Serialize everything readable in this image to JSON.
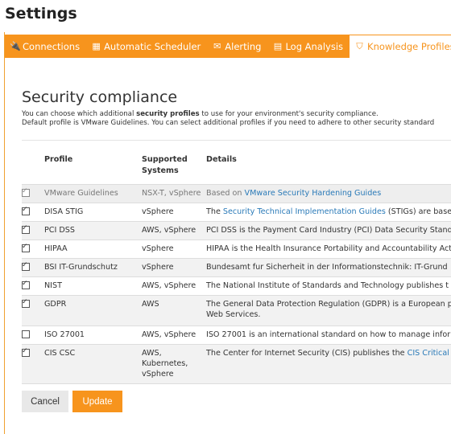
{
  "page": {
    "title": "Settings"
  },
  "tabs": [
    {
      "label": "Connections",
      "icon": "plug-icon",
      "glyph": "🔌"
    },
    {
      "label": "Automatic Scheduler",
      "icon": "calendar-icon",
      "glyph": "▦"
    },
    {
      "label": "Alerting",
      "icon": "envelope-icon",
      "glyph": "✉"
    },
    {
      "label": "Log Analysis",
      "icon": "book-icon",
      "glyph": "▤"
    },
    {
      "label": "Knowledge Profiles",
      "icon": "shield-icon",
      "glyph": "⛉",
      "active": true
    }
  ],
  "section": {
    "title": "Security compliance",
    "desc_line1_pre": "You can choose which additional ",
    "desc_line1_bold": "security profiles",
    "desc_line1_post": " to use for your environment's security compliance.",
    "desc_line2": "Default profile is VMware Guidelines. You can select additional profiles if you need to adhere to other security standard"
  },
  "table": {
    "headers": {
      "profile": "Profile",
      "systems": "Supported Systems",
      "details": "Details"
    },
    "rows": [
      {
        "checked": true,
        "disabled": true,
        "profile": "VMware Guidelines",
        "systems": "NSX-T, vSphere",
        "details_pre": "Based on ",
        "details_link": "VMware Security Hardening Guides",
        "details_post": ""
      },
      {
        "checked": true,
        "profile": "DISA STIG",
        "systems": "vSphere",
        "details_pre": "The ",
        "details_link": "Security Technical Implementation Guides",
        "details_post": " (STIGs) are base"
      },
      {
        "checked": true,
        "profile": "PCI DSS",
        "systems": "AWS, vSphere",
        "details_pre": "PCI DSS is the Payment Card Industry (PCI) Data Security Standa",
        "details_link": "",
        "details_post": ""
      },
      {
        "checked": true,
        "profile": "HIPAA",
        "systems": "vSphere",
        "details_pre": "HIPAA is the Health Insurance Portability and Accountability Act",
        "details_link": "",
        "details_post": ""
      },
      {
        "checked": true,
        "profile": "BSI IT-Grundschutz",
        "systems": "vSphere",
        "details_pre": "Bundesamt fur Sicherheit in der Informationstechnik: IT-Grund",
        "details_link": "",
        "details_post": ""
      },
      {
        "checked": true,
        "profile": "NIST",
        "systems": "AWS, vSphere",
        "details_pre": "The National Institute of Standards and Technology publishes t",
        "details_link": "",
        "details_post": ""
      },
      {
        "checked": true,
        "profile": "GDPR",
        "systems": "AWS",
        "details_pre": "The General Data Protection Regulation (GDPR) is a European p",
        "details_link": "",
        "details_post": "",
        "details_line2": "Web Services."
      },
      {
        "checked": false,
        "profile": "ISO 27001",
        "systems": "AWS, vSphere",
        "details_pre": "ISO 27001 is an international standard on how to manage infor",
        "details_link": "",
        "details_post": ""
      },
      {
        "checked": true,
        "profile": "CIS CSC",
        "systems": "AWS,",
        "systems_line2": "Kubernetes,",
        "systems_line3": "vSphere",
        "details_pre": "The Center for Internet Security (CIS) publishes the ",
        "details_link": "CIS Critical S",
        "details_post": ""
      }
    ]
  },
  "buttons": {
    "cancel": "Cancel",
    "update": "Update"
  },
  "colors": {
    "accent": "#f7941d",
    "link": "#2a7ab8"
  }
}
